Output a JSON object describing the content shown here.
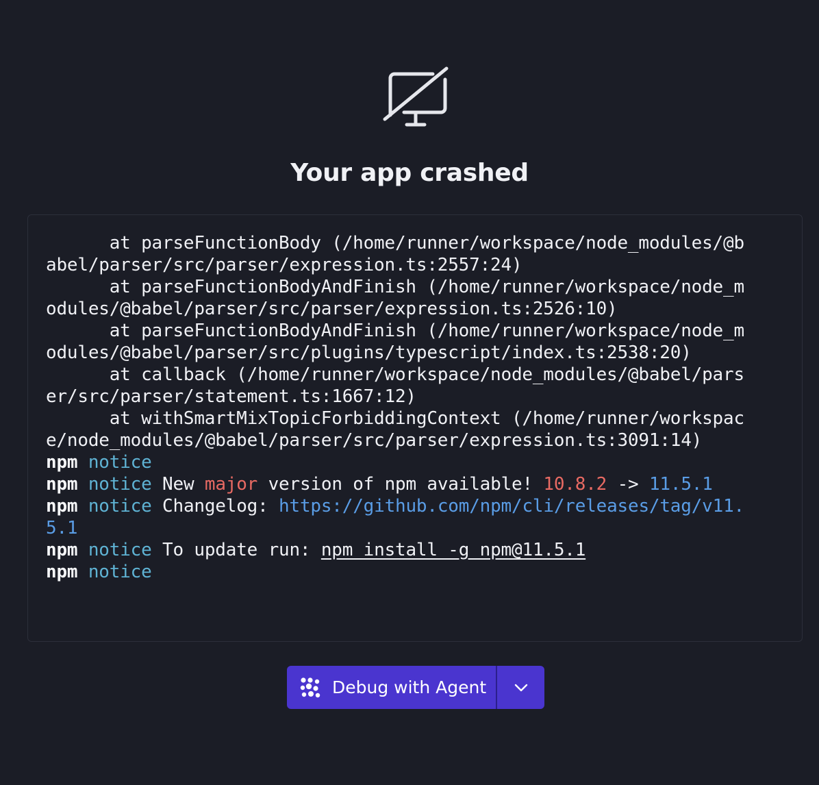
{
  "header": {
    "icon": "monitor-off-icon",
    "title": "Your app crashed"
  },
  "log": {
    "lines": [
      [
        {
          "t": "      at parseFunctionBody (/home/runner/workspace/node_modules/@b",
          "c": ""
        }
      ],
      [
        {
          "t": "abel/parser/src/parser/expression.ts:2557:24)",
          "c": ""
        }
      ],
      [
        {
          "t": "      at parseFunctionBodyAndFinish (/home/runner/workspace/node_m",
          "c": ""
        }
      ],
      [
        {
          "t": "odules/@babel/parser/src/parser/expression.ts:2526:10)",
          "c": ""
        }
      ],
      [
        {
          "t": "      at parseFunctionBodyAndFinish (/home/runner/workspace/node_m",
          "c": ""
        }
      ],
      [
        {
          "t": "odules/@babel/parser/src/plugins/typescript/index.ts:2538:20)",
          "c": ""
        }
      ],
      [
        {
          "t": "      at callback (/home/runner/workspace/node_modules/@babel/pars",
          "c": ""
        }
      ],
      [
        {
          "t": "er/src/parser/statement.ts:1667:12)",
          "c": ""
        }
      ],
      [
        {
          "t": "      at withSmartMixTopicForbiddingContext (/home/runner/workspac",
          "c": ""
        }
      ],
      [
        {
          "t": "e/node_modules/@babel/parser/src/parser/expression.ts:3091:14)",
          "c": ""
        }
      ],
      [
        {
          "t": "npm",
          "c": "npm"
        },
        {
          "t": " ",
          "c": ""
        },
        {
          "t": "notice",
          "c": "notice"
        }
      ],
      [
        {
          "t": "npm",
          "c": "npm"
        },
        {
          "t": " ",
          "c": ""
        },
        {
          "t": "notice",
          "c": "notice"
        },
        {
          "t": " New ",
          "c": ""
        },
        {
          "t": "major",
          "c": "major"
        },
        {
          "t": " version of npm available! ",
          "c": ""
        },
        {
          "t": "10.8.2",
          "c": "ver-old"
        },
        {
          "t": " -> ",
          "c": ""
        },
        {
          "t": "11.5.1",
          "c": "ver-new"
        }
      ],
      [
        {
          "t": "npm",
          "c": "npm"
        },
        {
          "t": " ",
          "c": ""
        },
        {
          "t": "notice",
          "c": "notice"
        },
        {
          "t": " Changelog: ",
          "c": ""
        },
        {
          "t": "https://github.com/npm/cli/releases/tag/v11.",
          "c": "link"
        }
      ],
      [
        {
          "t": "5.1",
          "c": "link"
        }
      ],
      [
        {
          "t": "npm",
          "c": "npm"
        },
        {
          "t": " ",
          "c": ""
        },
        {
          "t": "notice",
          "c": "notice"
        },
        {
          "t": " To update run: ",
          "c": ""
        },
        {
          "t": "npm install -g npm@11.5.1",
          "c": "cmd"
        }
      ],
      [
        {
          "t": "npm",
          "c": "npm"
        },
        {
          "t": " ",
          "c": ""
        },
        {
          "t": "notice",
          "c": "notice"
        }
      ]
    ]
  },
  "actions": {
    "debug_label": "Debug with Agent",
    "debug_icon": "agent-icon",
    "dropdown_icon": "chevron-down-icon"
  },
  "colors": {
    "background": "#1b1d26",
    "button": "#4a35cf",
    "notice": "#5fb3d4",
    "highlight_red": "#e86a63",
    "highlight_blue": "#5a9de6"
  }
}
